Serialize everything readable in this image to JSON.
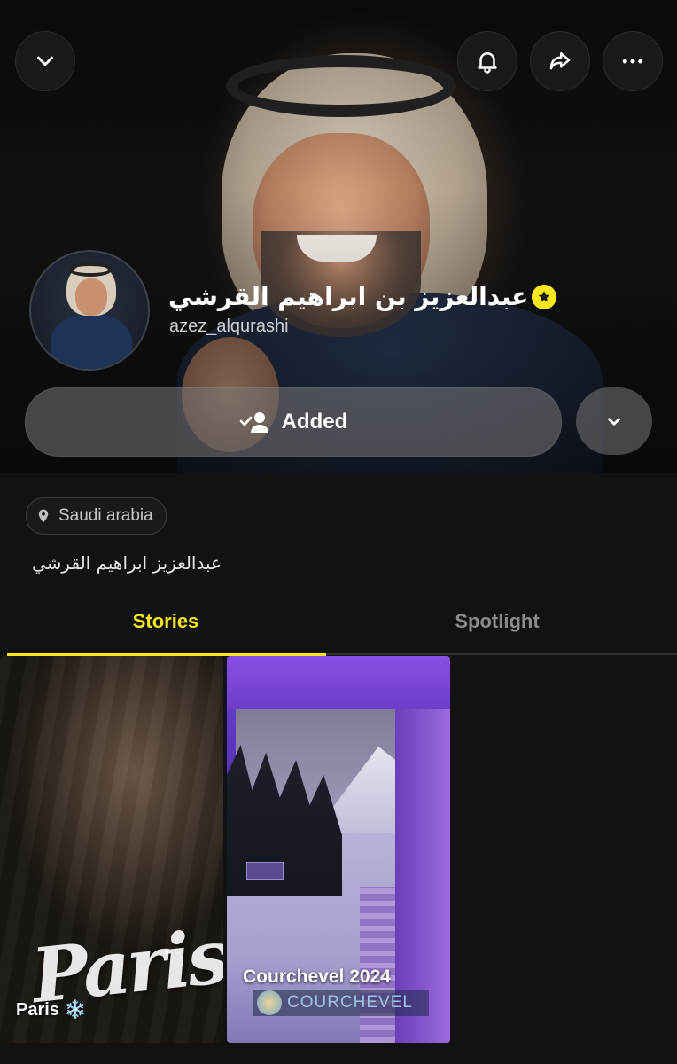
{
  "profile": {
    "display_name": "عبدالعزيز بن ابراهيم القرشي",
    "username": "azez_alqurashi",
    "location": "Saudi arabia",
    "bio": "عبدالعزيز ابراهيم القرشي"
  },
  "actions": {
    "friend_status_label": "Added"
  },
  "tabs": [
    {
      "label": "Stories",
      "active": true
    },
    {
      "label": "Spotlight",
      "active": false
    }
  ],
  "stories": [
    {
      "title": "Paris ❄️",
      "overlay_text": "Paris"
    },
    {
      "title": "Courchevel 2024",
      "overlay_text": "COURCHEVEL"
    }
  ],
  "icons": {
    "collapse": "chevron-down-icon",
    "notifications": "bell-icon",
    "share": "share-arrow-icon",
    "more": "more-dots-icon",
    "verified": "star-badge-icon",
    "friend_added": "user-check-icon",
    "friend_options": "chevron-down-icon",
    "location": "location-pin-icon"
  },
  "colors": {
    "accent": "#f7e81c",
    "background": "#121212",
    "inactive_tab": "#8a8a8a"
  }
}
